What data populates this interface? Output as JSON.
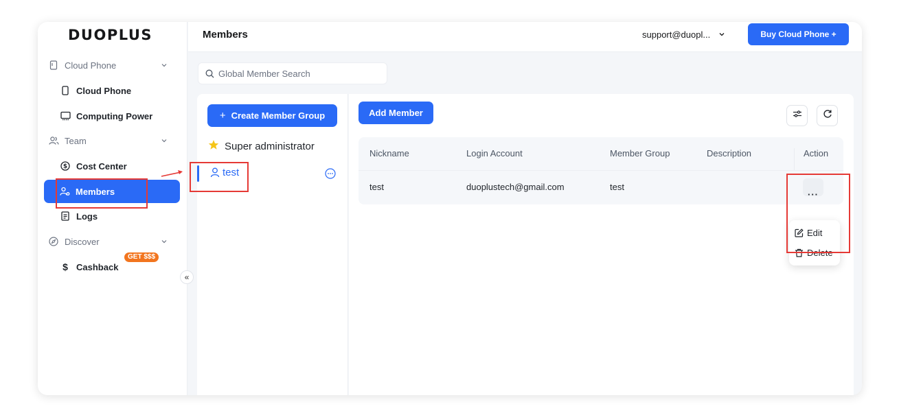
{
  "brand": {
    "logo_text": "DUOPLUS",
    "accent": "#2a6af6",
    "badge_color": "#f2751f"
  },
  "sidebar": {
    "items": [
      {
        "label": "Cloud Phone",
        "type": "group",
        "icon": "phone-frame-icon"
      },
      {
        "label": "Cloud Phone",
        "type": "child",
        "icon": "phone-icon"
      },
      {
        "label": "Computing Power",
        "type": "child",
        "icon": "monitor-icon"
      },
      {
        "label": "Team",
        "type": "group",
        "icon": "team-icon"
      },
      {
        "label": "Cost Center",
        "type": "child",
        "icon": "dollar-circle-icon"
      },
      {
        "label": "Members",
        "type": "child",
        "icon": "members-icon",
        "active": true
      },
      {
        "label": "Logs",
        "type": "child",
        "icon": "document-icon"
      },
      {
        "label": "Discover",
        "type": "group",
        "icon": "compass-icon"
      },
      {
        "label": "Cashback",
        "type": "child",
        "icon": "dollar-icon",
        "badge": "GET $$$"
      }
    ],
    "collapse_glyph": "«"
  },
  "header": {
    "title": "Members",
    "account": "support@duopl...",
    "buy_button": "Buy Cloud Phone +"
  },
  "search": {
    "placeholder": "Global Member Search"
  },
  "groups": {
    "create_button": "Create Member Group",
    "create_plus": "+",
    "items": [
      {
        "label": "Super administrator",
        "icon": "star-icon"
      },
      {
        "label": "test",
        "icon": "user-icon",
        "selected": true
      }
    ]
  },
  "members": {
    "add_button": "Add Member",
    "columns": [
      "Nickname",
      "Login Account",
      "Member Group",
      "Description",
      "Action"
    ],
    "rows": [
      {
        "nickname": "test",
        "login_account": "duoplustech@gmail.com",
        "member_group": "test",
        "description": "",
        "action": "···"
      }
    ]
  },
  "action_menu": {
    "edit": "Edit",
    "delete": "Delete"
  }
}
